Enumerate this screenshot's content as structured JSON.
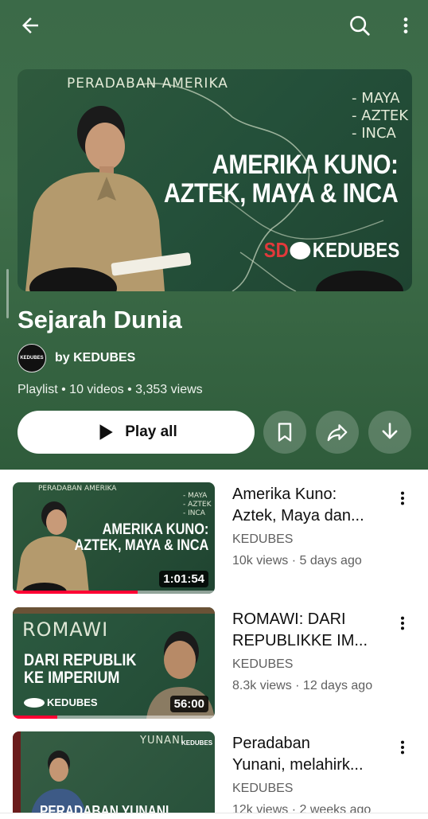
{
  "header": {
    "back_icon": "arrow-left-icon",
    "search_icon": "search-icon",
    "more_icon": "more-vert-icon"
  },
  "hero": {
    "board_top": "PERADABAN AMERIKA",
    "board_list": [
      "- MAYA",
      "- AZTEK",
      "- INCA"
    ],
    "big_line1": "AMERIKA KUNO:",
    "big_line2": "AZTEK, MAYA & INCA",
    "brand_sd": "SD",
    "brand_name": "KEDUBES"
  },
  "playlist": {
    "title": "Sejarah Dunia",
    "avatar_text": "KEDUBES",
    "owner": "by KEDUBES",
    "meta": "Playlist • 10 videos • 3,353 views",
    "play_all": "Play all"
  },
  "videos": [
    {
      "title_line1": "Amerika Kuno:",
      "title_line2": "Aztek, Maya dan...",
      "channel": "KEDUBES",
      "stats": "10k views · 5 days ago",
      "duration": "1:01:54",
      "progress": 0.62,
      "thumb_top": "PERADABAN AMERIKA",
      "thumb_line1": "AMERIKA KUNO:",
      "thumb_line2": "AZTEK, MAYA & INCA",
      "thumb_list": [
        "- MAYA",
        "- AZTEK",
        "- INCA"
      ]
    },
    {
      "title_line1": "ROMAWI: DARI",
      "title_line2": "REPUBLIKKE IM...",
      "channel": "KEDUBES",
      "stats": "8.3k views · 12 days ago",
      "duration": "56:00",
      "progress": 0.22,
      "thumb_top": "ROMAWI",
      "thumb_line1": "DARI REPUBLIK",
      "thumb_line2": "KE IMPERIUM",
      "thumb_brand": "KEDUBES"
    },
    {
      "title_line1": "Peradaban",
      "title_line2": "Yunani, melahirk...",
      "channel": "KEDUBES",
      "stats": "12k views · 2 weeks ago",
      "thumb_top": "YUNANI",
      "thumb_line1": "PERADABAN YUNANI",
      "thumb_brand": "KEDUBES"
    }
  ],
  "colors": {
    "header_green": "#3b6a48",
    "brand_red": "#e2393b",
    "progress_red": "#ff0033"
  }
}
